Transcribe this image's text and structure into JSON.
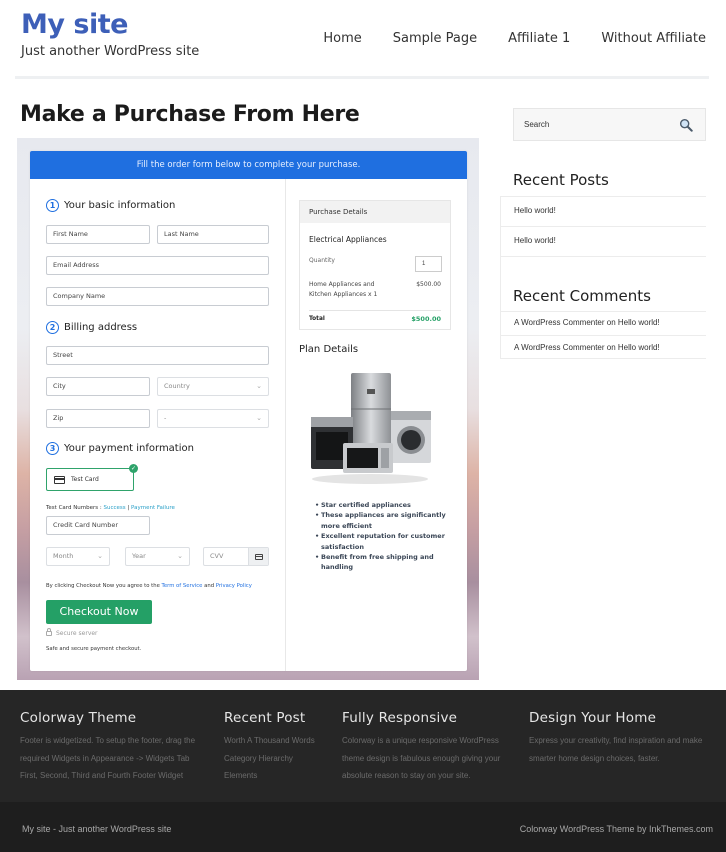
{
  "header": {
    "site_title": "My site",
    "tagline": "Just another WordPress site",
    "nav": [
      "Home",
      "Sample Page",
      "Affiliate 1",
      "Without Affiliate"
    ]
  },
  "page": {
    "title": "Make a Purchase From Here"
  },
  "checkout": {
    "banner": "Fill the order form below to complete your purchase.",
    "sections": {
      "basic": {
        "num": "1",
        "title": "Your basic information"
      },
      "billing": {
        "num": "2",
        "title": "Billing address"
      },
      "payment": {
        "num": "3",
        "title": "Your payment information"
      }
    },
    "fields": {
      "first_name": "First Name",
      "last_name": "Last Name",
      "email": "Email Address",
      "company": "Company Name",
      "street": "Street",
      "city": "City",
      "country": "Country",
      "zip": "Zip",
      "state": "-",
      "card_number": "Credit Card Number",
      "month": "Month",
      "year": "Year",
      "cvv": "CVV"
    },
    "payment_method": "Test Card",
    "test_cards_label": "Test Card Numbers : ",
    "test_success": "Success",
    "test_separator": " | ",
    "test_failure": "Payment Failure",
    "agree_prefix": "By clicking Checkout Now you agree to the ",
    "terms": "Term of Service",
    "agree_and": " and ",
    "privacy": "Privacy Policy",
    "checkout_button": "Checkout Now",
    "secure_server": "Secure server",
    "secure_note": "Safe and secure payment checkout.",
    "purchase_details": {
      "heading": "Purchase Details",
      "product": "Electrical Appliances",
      "quantity_label": "Quantity",
      "quantity": "1",
      "item_line1": "Home Appliances and",
      "item_line2": "Kitchen Appliances x 1",
      "item_price": "$500.00",
      "total_label": "Total",
      "total": "$500.00",
      "total_color": "#24a066"
    },
    "plan": {
      "title": "Plan Details",
      "image_label": "home-appliances-image",
      "features": [
        "Star certified appliances",
        "These appliances are significantly more efficient",
        "Excellent reputation for customer satisfaction",
        "Benefit from free shipping and handling"
      ]
    }
  },
  "sidebar": {
    "search_placeholder": "Search",
    "recent_posts_title": "Recent Posts",
    "recent_posts": [
      "Hello world!",
      "Hello world!"
    ],
    "recent_comments_title": "Recent Comments",
    "recent_comments": [
      "A WordPress Commenter on Hello world!",
      "A WordPress Commenter on Hello world!"
    ]
  },
  "footer": {
    "columns": [
      {
        "title": "Colorway Theme",
        "lines": [
          "Footer is widgetized. To setup the footer, drag the",
          "required Widgets in Appearance -> Widgets Tab",
          "First, Second, Third and Fourth Footer Widget"
        ]
      },
      {
        "title": "Recent Post",
        "lines": [
          "Worth A Thousand Words",
          "Category Hierarchy",
          "Elements"
        ]
      },
      {
        "title": "Fully Responsive",
        "lines": [
          "Colorway is a unique responsive WordPress",
          "theme design is fabulous enough giving your",
          "absolute reason to stay on your site."
        ]
      },
      {
        "title": "Design Your Home",
        "lines": [
          "Express your creativity, find inspiration and make",
          "smarter home design choices, faster."
        ]
      }
    ],
    "copyright_left": "My site - Just another WordPress site",
    "copyright_right": "Colorway WordPress Theme by InkThemes.com"
  },
  "colors": {
    "brand_blue": "#3d5fb8",
    "banner_blue": "#1f6fe0",
    "checkout_green": "#24a066",
    "footer_bg": "#262626"
  }
}
